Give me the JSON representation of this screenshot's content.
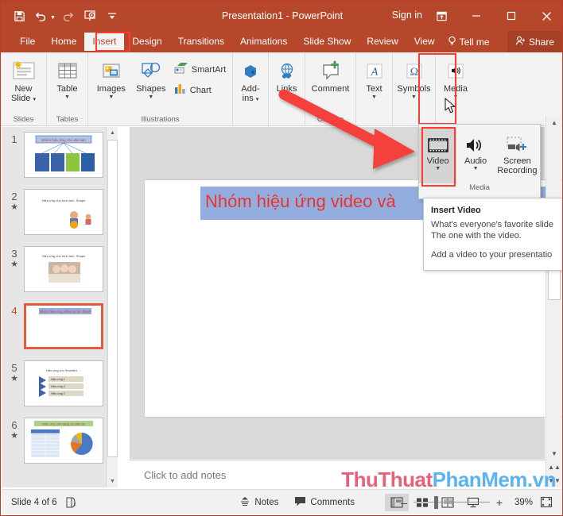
{
  "titlebar": {
    "title": "Presentation1  -  PowerPoint",
    "signin": "Sign in",
    "qat": [
      {
        "name": "save-icon",
        "label": "Save"
      },
      {
        "name": "undo-icon",
        "label": "Undo"
      },
      {
        "name": "redo-icon",
        "label": "Redo"
      },
      {
        "name": "start-presentation-icon",
        "label": "Start From Beginning"
      },
      {
        "name": "customize-quick-access-toolbar-icon",
        "label": "Customize Quick Access Toolbar"
      }
    ],
    "window": [
      {
        "name": "ribbon-display-options-icon",
        "glyph": "⊟"
      },
      {
        "name": "minimize-icon",
        "glyph": "–"
      },
      {
        "name": "maximize-icon",
        "glyph": "▢"
      },
      {
        "name": "close-icon",
        "glyph": "✕"
      }
    ]
  },
  "tabs": [
    {
      "label": "File",
      "active": false
    },
    {
      "label": "Home",
      "active": false
    },
    {
      "label": "Insert",
      "active": true
    },
    {
      "label": "Design",
      "active": false
    },
    {
      "label": "Transitions",
      "active": false
    },
    {
      "label": "Animations",
      "active": false
    },
    {
      "label": "Slide Show",
      "active": false
    },
    {
      "label": "Review",
      "active": false
    },
    {
      "label": "View",
      "active": false
    }
  ],
  "tellme": "Tell me",
  "share": "Share",
  "ribbon": {
    "groups": [
      {
        "label": "Slides",
        "buttons": [
          {
            "name": "new-slide-button",
            "label": "New\nSlide",
            "caret": true
          }
        ]
      },
      {
        "label": "Tables",
        "buttons": [
          {
            "name": "table-button",
            "label": "Table",
            "caret": true
          }
        ]
      },
      {
        "label": "Illustrations",
        "buttons": [
          {
            "name": "images-button",
            "label": "Images",
            "caret": true
          },
          {
            "name": "shapes-button",
            "label": "Shapes",
            "caret": true
          },
          {
            "name": "smartart-button",
            "label": "SmartArt",
            "caret": false
          },
          {
            "name": "chart-button",
            "label": "Chart",
            "caret": false
          }
        ]
      },
      {
        "label": "Add-ins",
        "buttons": [
          {
            "name": "add-ins-button",
            "label": "Add-\nins",
            "caret": true
          }
        ]
      },
      {
        "label": "Links",
        "buttons": [
          {
            "name": "links-button",
            "label": "Links",
            "caret": true
          }
        ]
      },
      {
        "label": "Comments",
        "buttons": [
          {
            "name": "comment-button",
            "label": "Comment",
            "caret": false
          }
        ]
      },
      {
        "label": "Text",
        "buttons": [
          {
            "name": "text-button",
            "label": "Text",
            "caret": true
          }
        ]
      },
      {
        "label": "Symbols",
        "buttons": [
          {
            "name": "symbols-button",
            "label": "Symbols",
            "caret": true
          }
        ]
      },
      {
        "label": "Media",
        "buttons": [
          {
            "name": "media-button",
            "label": "Media",
            "caret": true
          }
        ]
      }
    ],
    "labels": {
      "slides": "Slides",
      "tables": "Tables",
      "illustrations": "Illustrations",
      "comments": "Comme",
      "smartart": "SmartArt",
      "chart": "Chart",
      "new_slide": "New",
      "new_slide2": "Slide",
      "table": "Table",
      "images": "Images",
      "shapes": "Shapes",
      "addins": "Add-",
      "addins2": "ins",
      "links": "Links",
      "comment": "Comment",
      "text": "Text",
      "symbols": "Symbols",
      "media": "Media"
    }
  },
  "media_dropdown": {
    "group_label": "Media",
    "items": [
      {
        "name": "video-button",
        "label": "Video",
        "caret": true,
        "selected": true
      },
      {
        "name": "audio-button",
        "label": "Audio",
        "caret": true,
        "selected": false
      },
      {
        "name": "screen-recording-button",
        "label": "Screen",
        "label2": "Recording",
        "caret": false,
        "selected": false
      }
    ]
  },
  "tooltip": {
    "title": "Insert Video",
    "line1": "What's everyone's favorite slide",
    "line2": "The one with the video.",
    "footer": "Add a video to your presentatio"
  },
  "thumbnails": [
    {
      "number": "1",
      "star": false,
      "selected": false,
      "kind": "smartart"
    },
    {
      "number": "2",
      "star": true,
      "selected": false,
      "kind": "images2"
    },
    {
      "number": "3",
      "star": true,
      "selected": false,
      "kind": "photo"
    },
    {
      "number": "4",
      "star": false,
      "selected": true,
      "kind": "titleonly"
    },
    {
      "number": "5",
      "star": true,
      "selected": false,
      "kind": "smartart-list"
    },
    {
      "number": "6",
      "star": true,
      "selected": false,
      "kind": "table-chart"
    }
  ],
  "slide": {
    "title_text": "Nhóm hiệu ứng video và"
  },
  "notes": {
    "placeholder": "Click to add notes"
  },
  "statusbar": {
    "slide_count": "Slide 4 of 6",
    "language_icon": "language-icon",
    "notes_label": "Notes",
    "comments_label": "Comments",
    "zoom_percent": "39%",
    "views": [
      {
        "name": "view-normal",
        "active": true
      },
      {
        "name": "view-slide-sorter",
        "active": false
      },
      {
        "name": "view-reading",
        "active": false
      },
      {
        "name": "view-slide-show",
        "active": false
      }
    ],
    "zoom_minus": "–",
    "zoom_plus": "+"
  },
  "watermark": {
    "part1": "ThuThuat",
    "part2": "PhanMem.vn"
  },
  "colors": {
    "titlebar": "#b7472a",
    "accent_red": "#ff3b30",
    "slide_title_red": "#e8342a",
    "selected_thumb": "#e05c3d",
    "watermark_a": "#e8607a",
    "watermark_b": "#5bb3ef"
  }
}
